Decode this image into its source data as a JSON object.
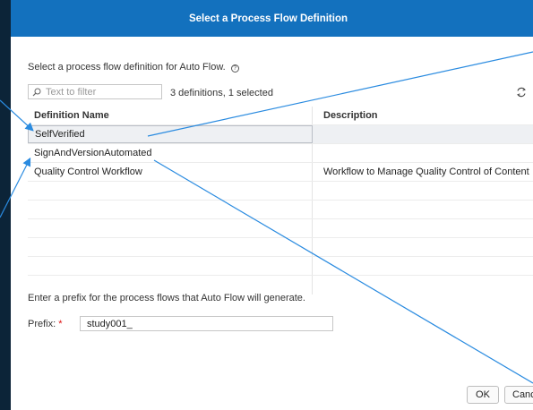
{
  "dialog": {
    "title": "Select a Process Flow Definition",
    "prompt": "Select a process flow definition for Auto Flow.",
    "info_icon": "info-icon"
  },
  "toolbar": {
    "filter_placeholder": "Text to filter",
    "count_text": "3 definitions, 1 selected",
    "refresh_icon": "refresh-icon"
  },
  "table": {
    "columns": [
      "Definition Name",
      "Description"
    ],
    "rows": [
      {
        "name": "SelfVerified",
        "description": "",
        "selected": true
      },
      {
        "name": "SignAndVersionAutomated",
        "description": "",
        "selected": false
      },
      {
        "name": "Quality Control Workflow",
        "description": "Workflow to Manage Quality Control of Content",
        "selected": false
      }
    ]
  },
  "prefix": {
    "instruction": "Enter a prefix for the process flows that Auto Flow will generate.",
    "label": "Prefix:",
    "required_marker": "*",
    "value": "study001_"
  },
  "buttons": {
    "ok": "OK",
    "cancel": "Cancel"
  },
  "colors": {
    "titlebar": "#1371be",
    "background": "#0c2438",
    "annotation_line": "#1a7fd4",
    "required": "#dd1111"
  }
}
